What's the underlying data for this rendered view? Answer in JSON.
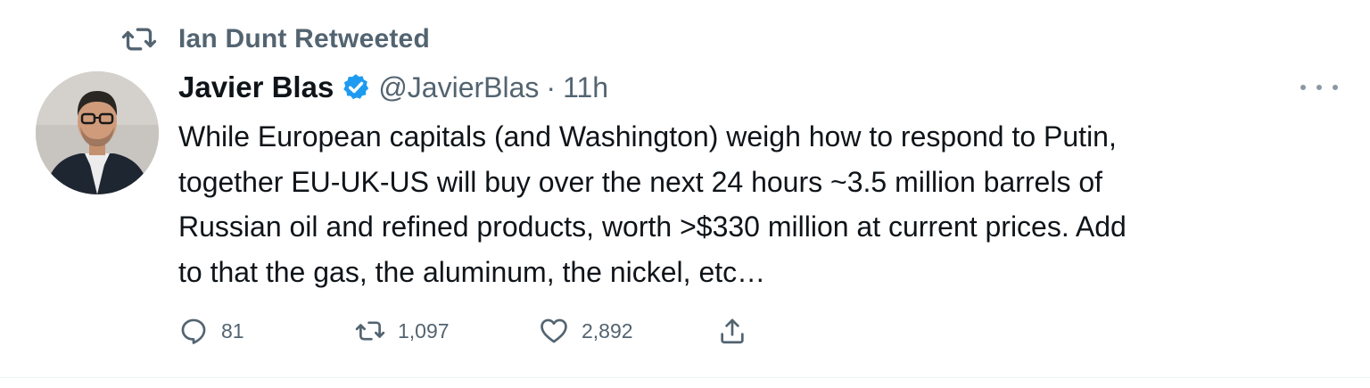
{
  "retweet_context": {
    "icon": "retweet-icon",
    "label": "Ian Dunt Retweeted"
  },
  "author": {
    "name": "Javier Blas",
    "verified": true,
    "handle": "@JavierBlas",
    "separator": "·",
    "time": "11h"
  },
  "tweet": {
    "lines": [
      "While European capitals (and Washington) weigh how to respond to Putin,",
      "together EU-UK-US will buy over the next 24 hours ~3.5 million barrels of",
      "Russian oil and refined products, worth >$330 million at current prices. Add",
      "to that the gas, the aluminum, the nickel, etc…"
    ]
  },
  "actions": {
    "reply": {
      "icon": "reply-icon",
      "count": "81"
    },
    "retweet": {
      "icon": "retweet-icon",
      "count": "1,097"
    },
    "like": {
      "icon": "heart-icon",
      "count": "2,892"
    },
    "share": {
      "icon": "share-icon"
    }
  },
  "colors": {
    "text": "#0f1419",
    "secondary": "#536471",
    "verified": "#1d9bf0",
    "divider": "#eff3f4"
  }
}
